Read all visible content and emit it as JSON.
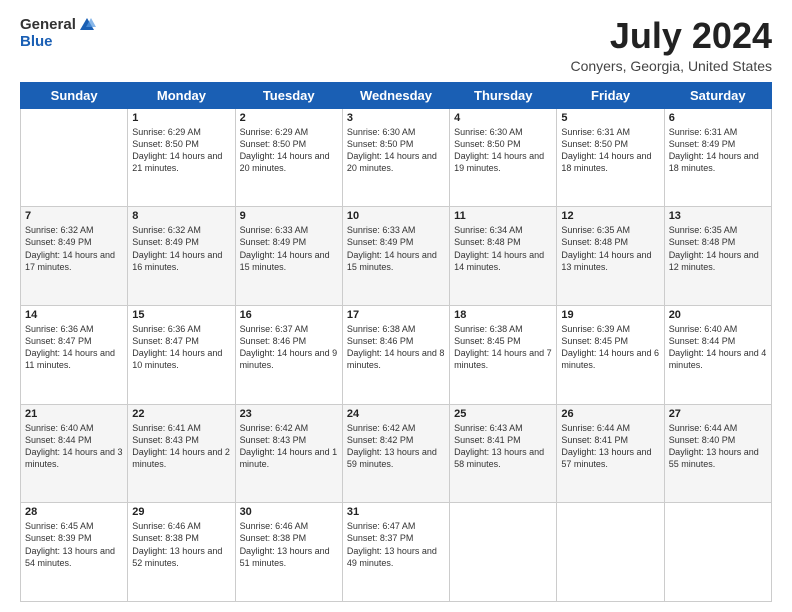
{
  "header": {
    "logo_general": "General",
    "logo_blue": "Blue",
    "month_year": "July 2024",
    "location": "Conyers, Georgia, United States"
  },
  "weekdays": [
    "Sunday",
    "Monday",
    "Tuesday",
    "Wednesday",
    "Thursday",
    "Friday",
    "Saturday"
  ],
  "weeks": [
    [
      {
        "day": "",
        "sunrise": "",
        "sunset": "",
        "daylight": ""
      },
      {
        "day": "1",
        "sunrise": "Sunrise: 6:29 AM",
        "sunset": "Sunset: 8:50 PM",
        "daylight": "Daylight: 14 hours and 21 minutes."
      },
      {
        "day": "2",
        "sunrise": "Sunrise: 6:29 AM",
        "sunset": "Sunset: 8:50 PM",
        "daylight": "Daylight: 14 hours and 20 minutes."
      },
      {
        "day": "3",
        "sunrise": "Sunrise: 6:30 AM",
        "sunset": "Sunset: 8:50 PM",
        "daylight": "Daylight: 14 hours and 20 minutes."
      },
      {
        "day": "4",
        "sunrise": "Sunrise: 6:30 AM",
        "sunset": "Sunset: 8:50 PM",
        "daylight": "Daylight: 14 hours and 19 minutes."
      },
      {
        "day": "5",
        "sunrise": "Sunrise: 6:31 AM",
        "sunset": "Sunset: 8:50 PM",
        "daylight": "Daylight: 14 hours and 18 minutes."
      },
      {
        "day": "6",
        "sunrise": "Sunrise: 6:31 AM",
        "sunset": "Sunset: 8:49 PM",
        "daylight": "Daylight: 14 hours and 18 minutes."
      }
    ],
    [
      {
        "day": "7",
        "sunrise": "Sunrise: 6:32 AM",
        "sunset": "Sunset: 8:49 PM",
        "daylight": "Daylight: 14 hours and 17 minutes."
      },
      {
        "day": "8",
        "sunrise": "Sunrise: 6:32 AM",
        "sunset": "Sunset: 8:49 PM",
        "daylight": "Daylight: 14 hours and 16 minutes."
      },
      {
        "day": "9",
        "sunrise": "Sunrise: 6:33 AM",
        "sunset": "Sunset: 8:49 PM",
        "daylight": "Daylight: 14 hours and 15 minutes."
      },
      {
        "day": "10",
        "sunrise": "Sunrise: 6:33 AM",
        "sunset": "Sunset: 8:49 PM",
        "daylight": "Daylight: 14 hours and 15 minutes."
      },
      {
        "day": "11",
        "sunrise": "Sunrise: 6:34 AM",
        "sunset": "Sunset: 8:48 PM",
        "daylight": "Daylight: 14 hours and 14 minutes."
      },
      {
        "day": "12",
        "sunrise": "Sunrise: 6:35 AM",
        "sunset": "Sunset: 8:48 PM",
        "daylight": "Daylight: 14 hours and 13 minutes."
      },
      {
        "day": "13",
        "sunrise": "Sunrise: 6:35 AM",
        "sunset": "Sunset: 8:48 PM",
        "daylight": "Daylight: 14 hours and 12 minutes."
      }
    ],
    [
      {
        "day": "14",
        "sunrise": "Sunrise: 6:36 AM",
        "sunset": "Sunset: 8:47 PM",
        "daylight": "Daylight: 14 hours and 11 minutes."
      },
      {
        "day": "15",
        "sunrise": "Sunrise: 6:36 AM",
        "sunset": "Sunset: 8:47 PM",
        "daylight": "Daylight: 14 hours and 10 minutes."
      },
      {
        "day": "16",
        "sunrise": "Sunrise: 6:37 AM",
        "sunset": "Sunset: 8:46 PM",
        "daylight": "Daylight: 14 hours and 9 minutes."
      },
      {
        "day": "17",
        "sunrise": "Sunrise: 6:38 AM",
        "sunset": "Sunset: 8:46 PM",
        "daylight": "Daylight: 14 hours and 8 minutes."
      },
      {
        "day": "18",
        "sunrise": "Sunrise: 6:38 AM",
        "sunset": "Sunset: 8:45 PM",
        "daylight": "Daylight: 14 hours and 7 minutes."
      },
      {
        "day": "19",
        "sunrise": "Sunrise: 6:39 AM",
        "sunset": "Sunset: 8:45 PM",
        "daylight": "Daylight: 14 hours and 6 minutes."
      },
      {
        "day": "20",
        "sunrise": "Sunrise: 6:40 AM",
        "sunset": "Sunset: 8:44 PM",
        "daylight": "Daylight: 14 hours and 4 minutes."
      }
    ],
    [
      {
        "day": "21",
        "sunrise": "Sunrise: 6:40 AM",
        "sunset": "Sunset: 8:44 PM",
        "daylight": "Daylight: 14 hours and 3 minutes."
      },
      {
        "day": "22",
        "sunrise": "Sunrise: 6:41 AM",
        "sunset": "Sunset: 8:43 PM",
        "daylight": "Daylight: 14 hours and 2 minutes."
      },
      {
        "day": "23",
        "sunrise": "Sunrise: 6:42 AM",
        "sunset": "Sunset: 8:43 PM",
        "daylight": "Daylight: 14 hours and 1 minute."
      },
      {
        "day": "24",
        "sunrise": "Sunrise: 6:42 AM",
        "sunset": "Sunset: 8:42 PM",
        "daylight": "Daylight: 13 hours and 59 minutes."
      },
      {
        "day": "25",
        "sunrise": "Sunrise: 6:43 AM",
        "sunset": "Sunset: 8:41 PM",
        "daylight": "Daylight: 13 hours and 58 minutes."
      },
      {
        "day": "26",
        "sunrise": "Sunrise: 6:44 AM",
        "sunset": "Sunset: 8:41 PM",
        "daylight": "Daylight: 13 hours and 57 minutes."
      },
      {
        "day": "27",
        "sunrise": "Sunrise: 6:44 AM",
        "sunset": "Sunset: 8:40 PM",
        "daylight": "Daylight: 13 hours and 55 minutes."
      }
    ],
    [
      {
        "day": "28",
        "sunrise": "Sunrise: 6:45 AM",
        "sunset": "Sunset: 8:39 PM",
        "daylight": "Daylight: 13 hours and 54 minutes."
      },
      {
        "day": "29",
        "sunrise": "Sunrise: 6:46 AM",
        "sunset": "Sunset: 8:38 PM",
        "daylight": "Daylight: 13 hours and 52 minutes."
      },
      {
        "day": "30",
        "sunrise": "Sunrise: 6:46 AM",
        "sunset": "Sunset: 8:38 PM",
        "daylight": "Daylight: 13 hours and 51 minutes."
      },
      {
        "day": "31",
        "sunrise": "Sunrise: 6:47 AM",
        "sunset": "Sunset: 8:37 PM",
        "daylight": "Daylight: 13 hours and 49 minutes."
      },
      {
        "day": "",
        "sunrise": "",
        "sunset": "",
        "daylight": ""
      },
      {
        "day": "",
        "sunrise": "",
        "sunset": "",
        "daylight": ""
      },
      {
        "day": "",
        "sunrise": "",
        "sunset": "",
        "daylight": ""
      }
    ]
  ]
}
